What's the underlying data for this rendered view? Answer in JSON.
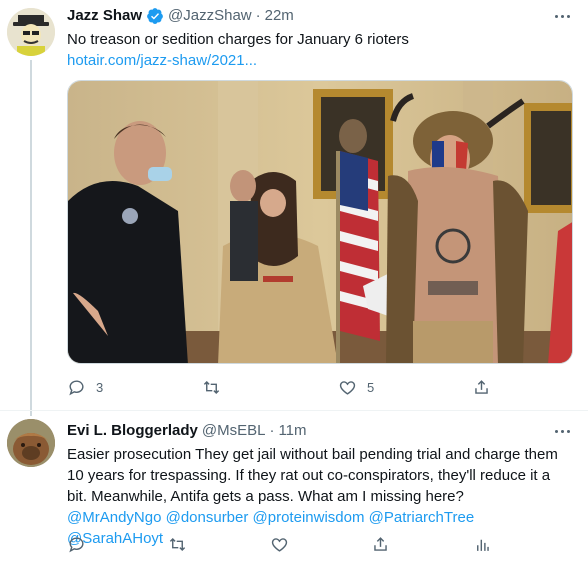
{
  "tweets": [
    {
      "name": "Jazz Shaw",
      "handle": "@JazzShaw",
      "separator": "·",
      "time": "22m",
      "text": "No treason or sedition charges for January 6 rioters",
      "link": "hotair.com/jazz-shaw/2021...",
      "media": "photo-capitol-rioters",
      "replies": "3",
      "retweets": "",
      "likes": "5"
    },
    {
      "name": "Evi L. Bloggerlady",
      "handle": "@MsEBL",
      "separator": "·",
      "time": "11m",
      "text": "Easier prosecution They get jail without bail pending trial and charge them 10 years for trespassing. If they rat out co-conspirators, they'll reduce it a bit. Meanwhile, Antifa gets a pass. What am I missing here?",
      "mentions": "@MrAndyNgo @donsurber @proteinwisdom @PatriarchTree @SarahAHoyt",
      "replies": "",
      "retweets": "",
      "likes": ""
    }
  ],
  "icons": [
    "verified-badge-icon",
    "more-icon",
    "reply-icon",
    "retweet-icon",
    "like-icon",
    "share-icon",
    "analytics-icon"
  ],
  "colors": {
    "link": "#1d9bf0",
    "secondary": "#536471",
    "verified": "#1d9bf0"
  }
}
